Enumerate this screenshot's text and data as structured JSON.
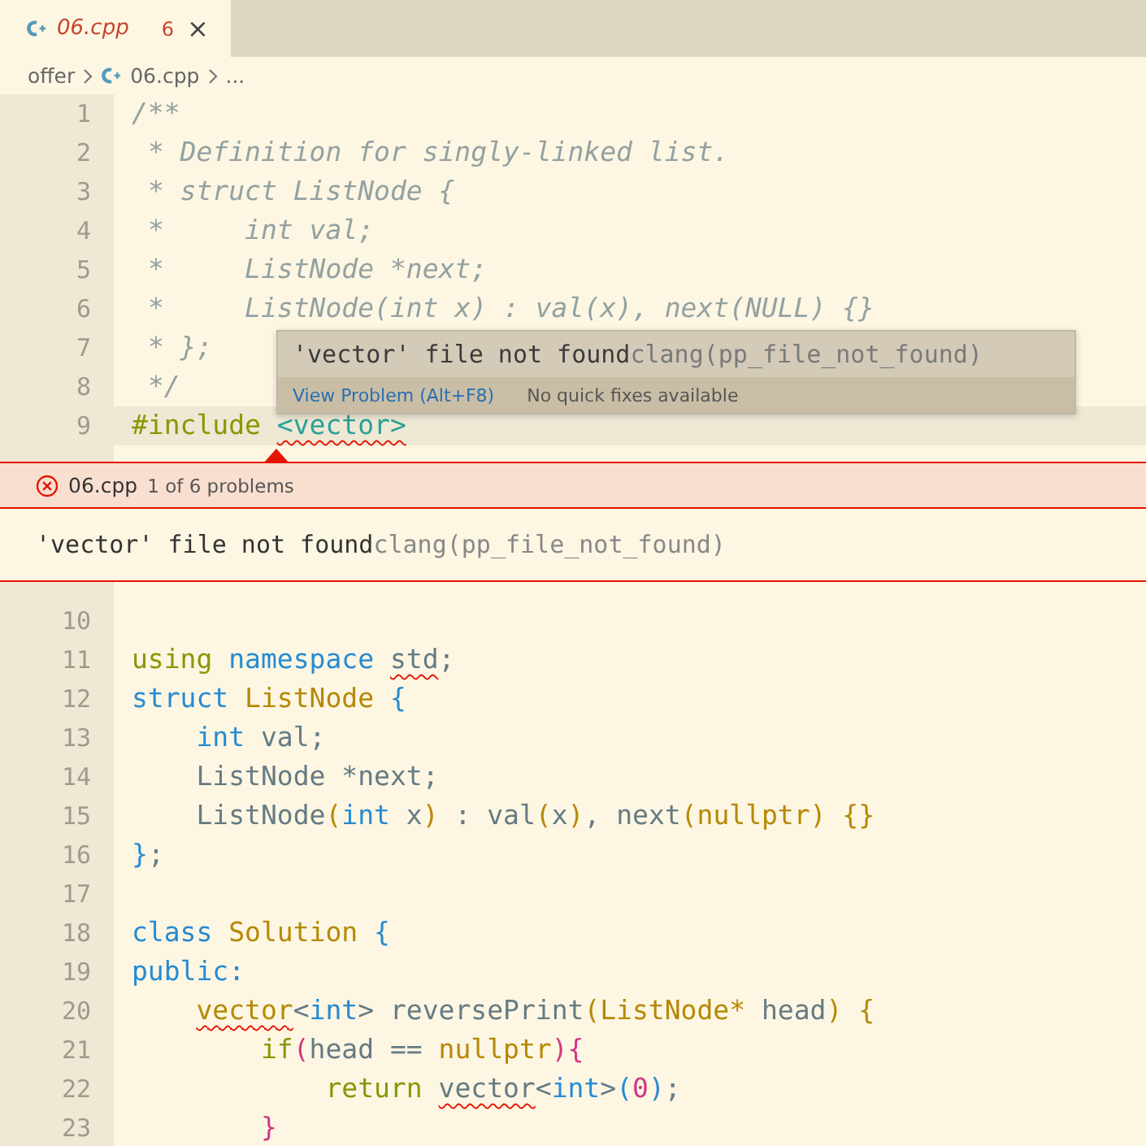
{
  "tab": {
    "label": "06.cpp",
    "problems": "6",
    "close": "×",
    "selected": true
  },
  "breadcrumb": [
    {
      "kind": "folder",
      "text": "offer"
    },
    {
      "kind": "file",
      "text": "06.cpp"
    },
    {
      "kind": "more",
      "text": "..."
    }
  ],
  "lines_above": [
    {
      "number": "1",
      "current": false,
      "tokens": [
        {
          "text": "/**",
          "kind": "comment"
        }
      ]
    },
    {
      "number": "2",
      "current": false,
      "tokens": [
        {
          "text": " * Definition for singly-linked list.",
          "kind": "comment"
        }
      ]
    },
    {
      "number": "3",
      "current": false,
      "tokens": [
        {
          "text": " * struct ListNode {",
          "kind": "comment"
        }
      ]
    },
    {
      "number": "4",
      "current": false,
      "tokens": [
        {
          "text": " *     int val;",
          "kind": "comment"
        }
      ]
    },
    {
      "number": "5",
      "current": false,
      "tokens": [
        {
          "text": " *     ListNode *next;",
          "kind": "comment"
        }
      ]
    },
    {
      "number": "6",
      "current": false,
      "tokens": [
        {
          "text": " *     ListNode(int x) : val(x), next(NULL) {}",
          "kind": "comment"
        }
      ]
    },
    {
      "number": "7",
      "current": false,
      "tokens": [
        {
          "text": " * };",
          "kind": "comment"
        }
      ]
    },
    {
      "number": "8",
      "current": false,
      "tokens": [
        {
          "text": " */",
          "kind": "comment"
        }
      ]
    },
    {
      "number": "9",
      "current": true,
      "tokens": [
        {
          "text": "#include ",
          "kind": "directive"
        },
        {
          "text": "<vector>",
          "kind": "string",
          "error": true
        }
      ]
    }
  ],
  "hover": {
    "message": "'vector' file not found",
    "source": "clang(pp_file_not_found)",
    "action": "View Problem (Alt+F8)",
    "note": "No quick fixes available"
  },
  "peek": {
    "file": "06.cpp",
    "position": "1 of 6 problems",
    "message": "'vector' file not found",
    "source": "clang(pp_file_not_found)"
  },
  "lines_below": [
    {
      "number": "10",
      "current": false
    },
    {
      "number": "11",
      "current": false,
      "tokens": [
        {
          "text": "using ",
          "kind": "control"
        },
        {
          "text": "namespace ",
          "kind": "keyword"
        },
        {
          "text": "std",
          "kind": "plain",
          "error": true
        },
        {
          "text": ";",
          "kind": "plain"
        }
      ]
    },
    {
      "number": "12",
      "current": false,
      "tokens": [
        {
          "text": "struct ",
          "kind": "keyword"
        },
        {
          "text": "ListNode ",
          "kind": "type"
        },
        {
          "text": "{",
          "kind": "brace_blue"
        }
      ]
    },
    {
      "number": "13",
      "current": false,
      "tokens": [
        {
          "text": "    int",
          "kind": "keyword"
        },
        {
          "text": " val;",
          "kind": "plain"
        }
      ]
    },
    {
      "number": "14",
      "current": false,
      "tokens": [
        {
          "text": "    ListNode *next;",
          "kind": "plain"
        }
      ]
    },
    {
      "number": "15",
      "current": false,
      "tokens": [
        {
          "text": "    ListNode",
          "kind": "plain"
        },
        {
          "text": "(",
          "kind": "brace_gold"
        },
        {
          "text": "int",
          "kind": "keyword"
        },
        {
          "text": " x",
          "kind": "plain"
        },
        {
          "text": ")",
          "kind": "brace_gold"
        },
        {
          "text": " : val",
          "kind": "plain"
        },
        {
          "text": "(",
          "kind": "brace_gold"
        },
        {
          "text": "x",
          "kind": "plain"
        },
        {
          "text": ")",
          "kind": "brace_gold"
        },
        {
          "text": ", next",
          "kind": "plain"
        },
        {
          "text": "(nullptr) {}",
          "kind": "brace_gold"
        }
      ]
    },
    {
      "number": "16",
      "current": false,
      "tokens": [
        {
          "text": "}",
          "kind": "brace_blue"
        },
        {
          "text": ";",
          "kind": "plain"
        }
      ]
    },
    {
      "number": "17",
      "current": false
    },
    {
      "number": "18",
      "current": false,
      "tokens": [
        {
          "text": "class ",
          "kind": "keyword"
        },
        {
          "text": "Solution ",
          "kind": "type"
        },
        {
          "text": "{",
          "kind": "brace_blue"
        }
      ]
    },
    {
      "number": "19",
      "current": false,
      "tokens": [
        {
          "text": "public:",
          "kind": "keyword"
        }
      ]
    },
    {
      "number": "20",
      "current": false,
      "tokens": [
        {
          "text": "    vector",
          "kind": "type",
          "error": true
        },
        {
          "text": "<",
          "kind": "plain"
        },
        {
          "text": "int",
          "kind": "keyword"
        },
        {
          "text": "> reversePrint",
          "kind": "plain"
        },
        {
          "text": "(ListNode*",
          "kind": "brace_gold"
        },
        {
          "text": " head",
          "kind": "plain"
        },
        {
          "text": ") {",
          "kind": "brace_gold"
        }
      ]
    },
    {
      "number": "21",
      "current": false,
      "tokens": [
        {
          "text": "        if",
          "kind": "control"
        },
        {
          "text": "(",
          "kind": "brace_magenta"
        },
        {
          "text": "head == ",
          "kind": "plain"
        },
        {
          "text": "nullptr",
          "kind": "type"
        },
        {
          "text": "){",
          "kind": "brace_magenta"
        }
      ]
    },
    {
      "number": "22",
      "current": false,
      "tokens": [
        {
          "text": "            return ",
          "kind": "control"
        },
        {
          "text": "vector",
          "kind": "plain",
          "error": true
        },
        {
          "text": "<",
          "kind": "plain"
        },
        {
          "text": "int",
          "kind": "keyword"
        },
        {
          "text": ">",
          "kind": "plain"
        },
        {
          "text": "(",
          "kind": "brace_blue"
        },
        {
          "text": "0",
          "kind": "number"
        },
        {
          "text": ")",
          "kind": "brace_blue"
        },
        {
          "text": ";",
          "kind": "plain"
        }
      ]
    },
    {
      "number": "23",
      "current": false,
      "tokens": [
        {
          "text": "        }",
          "kind": "brace_magenta"
        }
      ]
    }
  ]
}
